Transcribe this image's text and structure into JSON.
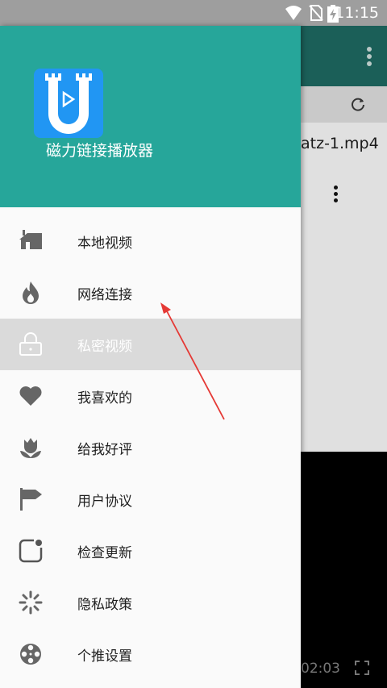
{
  "status_bar": {
    "time": "11:15",
    "icons": [
      "wifi-icon",
      "no-sim-icon",
      "battery-charging-icon"
    ]
  },
  "background_app": {
    "file_name": "atz-1.mp4",
    "video_duration": "02:03",
    "icons": [
      "more-vert-icon",
      "refresh-icon",
      "file-menu-icon",
      "fullscreen-icon"
    ]
  },
  "drawer": {
    "app_name": "磁力链接播放器",
    "header_color": "#26a69a",
    "menu": [
      {
        "label": "本地视频",
        "icon": "house-icon"
      },
      {
        "label": "网络连接",
        "icon": "flame-icon"
      },
      {
        "label": "私密视频",
        "icon": "lock-icon",
        "active": true
      },
      {
        "label": "我喜欢的",
        "icon": "heart-icon"
      },
      {
        "label": "给我好评",
        "icon": "tulip-icon"
      },
      {
        "label": "用户协议",
        "icon": "flag-icon"
      },
      {
        "label": "检查更新",
        "icon": "update-icon"
      },
      {
        "label": "隐私政策",
        "icon": "spinner-icon"
      },
      {
        "label": "个推设置",
        "icon": "film-reel-icon"
      }
    ]
  },
  "annotation": {
    "arrow_color": "#e53935"
  }
}
